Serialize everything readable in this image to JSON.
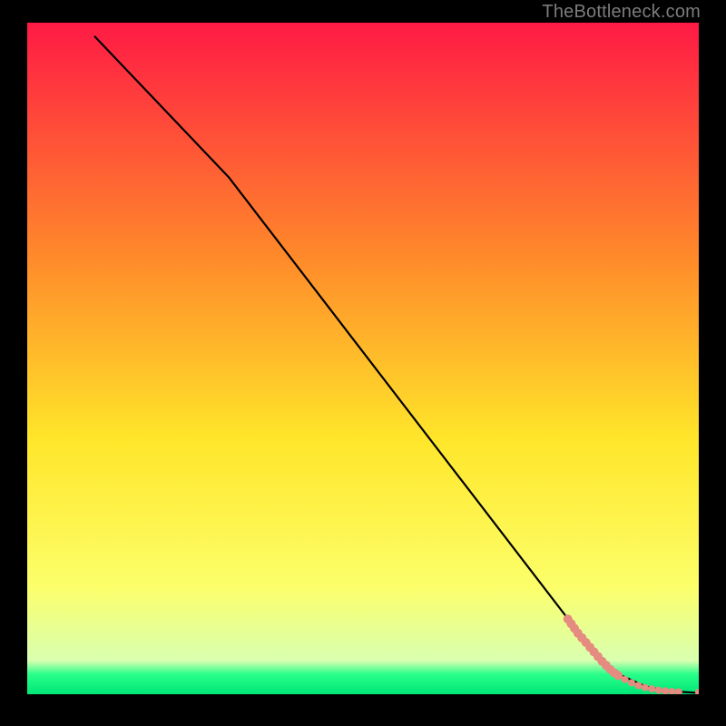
{
  "attribution": "TheBottleneck.com",
  "chart_data": {
    "type": "line",
    "title": "",
    "xlabel": "",
    "ylabel": "",
    "xlim": [
      0,
      100
    ],
    "ylim": [
      0,
      100
    ],
    "background_gradient_colors": {
      "top": "#ff1a45",
      "mid_upper": "#ff8a2a",
      "mid": "#ffe62a",
      "mid_lower": "#fcff6a",
      "bottom_band": "#2aff8a",
      "bottom": "#00e676"
    },
    "series": [
      {
        "name": "curve",
        "kind": "line",
        "color": "#000000",
        "x": [
          10,
          30,
          83,
          88,
          92,
          95,
          100
        ],
        "y": [
          98,
          77,
          8,
          3,
          1.2,
          0.5,
          0.2
        ]
      },
      {
        "name": "dots",
        "kind": "scatter",
        "color": "#e58b80",
        "x": [
          80.5,
          81,
          81.5,
          82,
          82.6,
          83.2,
          83.8,
          84.4,
          85,
          85.6,
          86.2,
          86.8,
          87.4,
          88,
          89,
          90,
          91,
          92,
          93,
          94,
          95,
          96,
          97,
          100
        ],
        "y": [
          11.2,
          10.5,
          9.8,
          9.1,
          8.4,
          7.7,
          7.0,
          6.3,
          5.6,
          4.9,
          4.3,
          3.7,
          3.2,
          2.8,
          2.2,
          1.7,
          1.3,
          1.0,
          0.8,
          0.6,
          0.5,
          0.4,
          0.35,
          0.3
        ],
        "sizes": [
          5,
          5,
          5,
          5,
          5,
          5,
          5,
          5,
          5,
          5,
          5,
          5,
          5,
          5,
          4,
          4,
          4,
          4,
          4,
          4,
          4,
          4,
          4,
          4
        ]
      }
    ]
  }
}
